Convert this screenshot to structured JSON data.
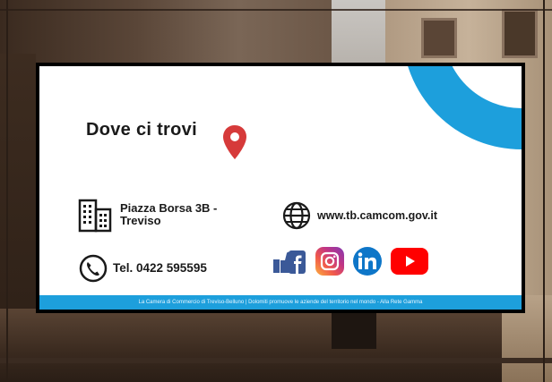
{
  "panel": {
    "title": "Dove ci trovi",
    "address_line1": "Piazza Borsa 3B -",
    "address_line2": "Treviso",
    "website": "www.tb.camcom.gov.it",
    "phone": "Tel. 0422 595595",
    "social_icons": [
      "facebook-icon",
      "instagram-icon",
      "linkedin-icon",
      "youtube-icon"
    ],
    "footer": "La Camera di Commercio di Treviso-Belluno | Dolomiti promuove le aziende del territorio nel mondo  -  Alla Rete Gamma",
    "colors": {
      "accent": "#1d9fdc",
      "pin": "#d63a3a"
    }
  }
}
